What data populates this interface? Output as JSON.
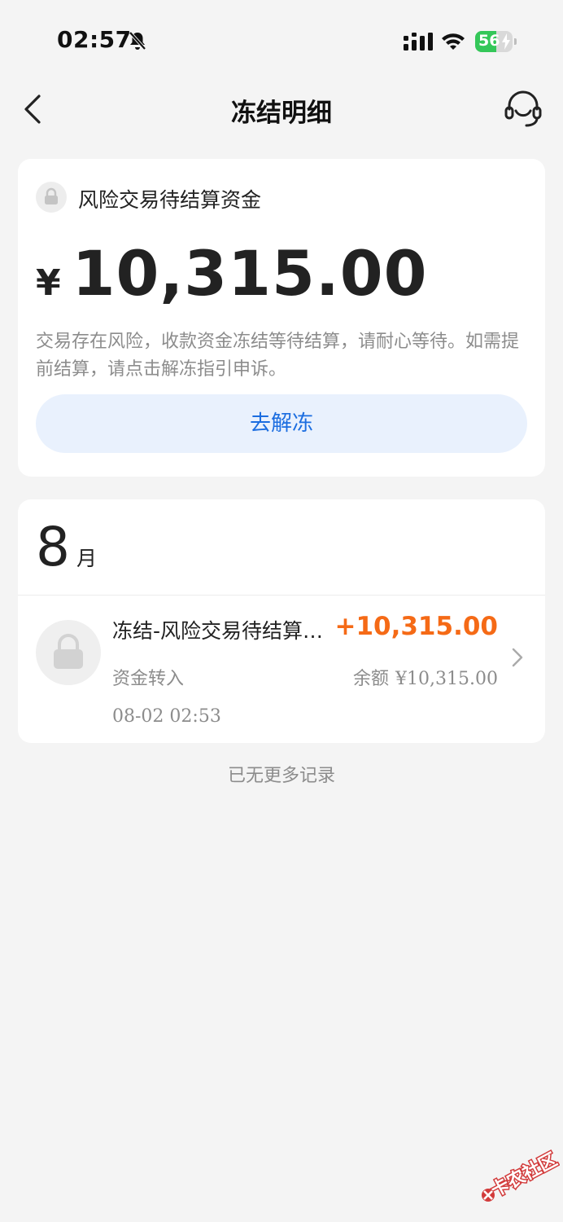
{
  "status_bar": {
    "time": "02:57",
    "battery_level": 56,
    "battery_text": "56",
    "icons": [
      "bell-slash-icon",
      "cellular-signal-icon",
      "wifi-icon",
      "battery-charging-icon"
    ]
  },
  "nav": {
    "title": "冻结明细",
    "back_icon": "chevron-left-icon",
    "service_icon": "customer-service-headset-icon"
  },
  "freeze_card": {
    "icon": "lock-icon",
    "label": "风险交易待结算资金",
    "currency": "¥",
    "amount": "10,315.00",
    "description": "交易存在风险，收款资金冻结等待结算，请耐心等待。如需提前结算，请点击解冻指引申诉。",
    "button_label": "去解冻",
    "button_text_color": "#1b6de0",
    "button_bg_color": "#e9f1fd"
  },
  "records": {
    "month_number": "8",
    "month_unit": "月",
    "items": [
      {
        "icon": "lock-icon",
        "title": "冻结-风险交易待结算资金",
        "amount": "+10,315.00",
        "amount_color": "#f56a16",
        "type": "资金转入",
        "balance_label": "余额",
        "balance_value": "¥10,315.00",
        "time": "08-02 02:53"
      }
    ],
    "end_text": "已无更多记录"
  },
  "watermark": {
    "text": "卡农社区"
  }
}
